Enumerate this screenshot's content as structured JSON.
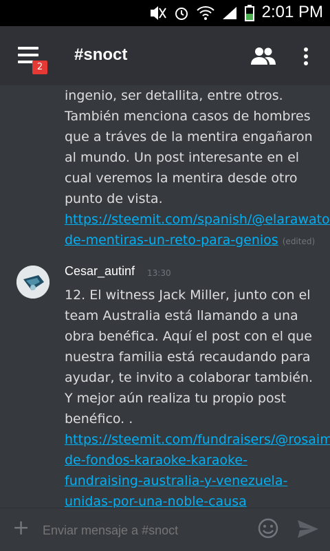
{
  "status": {
    "time": "2:01 PM"
  },
  "header": {
    "title": "#snoct",
    "badge": "2"
  },
  "messages": {
    "first": {
      "text": "ingenio, ser detallita, entre otros. También menciona casos de hombres que a tráves de la mentira engañaron al mundo. Un post interesante en el cual veremos la mentira desde otro punto de vista. ",
      "link": "https://steemit.com/spanish/@elarawatodigital/juego-de-mentiras-un-reto-para-genios",
      "edited": "(edited)"
    },
    "second": {
      "author": "Cesar_autinf",
      "time": "13:30",
      "text": "12. El witness Jack Miller, junto con el team Australia está llamando a una obra benéfica.  Aquí el post con el que nuestra familia está recaudando para ayudar,  te invito a colaborar también. Y mejor aún realiza tu propio post benéfico. .  ",
      "link": "https://steemit.com/fundraisers/@rosaimm/recaudacion-de-fondos-karaoke-karaoke-fundraising-australia-y-venezuela-unidas-por-una-noble-causa"
    }
  },
  "composer": {
    "placeholder": "Enviar mensaje a #snoct"
  }
}
